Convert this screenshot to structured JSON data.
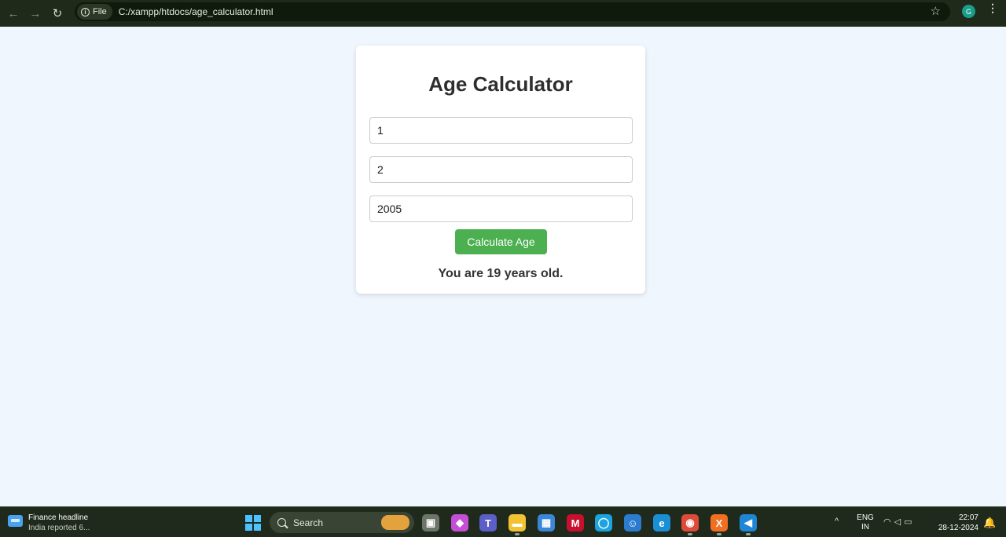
{
  "browser": {
    "back_glyph": "←",
    "forward_glyph": "→",
    "reload_glyph": "↻",
    "file_chip_label": "File",
    "info_glyph": "i",
    "url": "C:/xampp/htdocs/age_calculator.html",
    "star_glyph": "☆",
    "profile_initial": "G",
    "menu_glyph": "⋮"
  },
  "app": {
    "title": "Age Calculator",
    "day_value": "1",
    "month_value": "2",
    "year_value": "2005",
    "button_label": "Calculate Age",
    "result_text": "You are 19 years old.",
    "button_color": "#4caf50"
  },
  "taskbar": {
    "widget_title": "Finance headline",
    "widget_subtitle": "India reported 6...",
    "search_label": "Search",
    "apps": [
      {
        "name": "task-view",
        "glyph": "▣",
        "color": "#6d7468"
      },
      {
        "name": "copilot",
        "glyph": "◆",
        "color": "#c44fd6"
      },
      {
        "name": "teams",
        "glyph": "T",
        "color": "#5b5fc7"
      },
      {
        "name": "file-explorer",
        "glyph": "▬",
        "color": "#f2c233"
      },
      {
        "name": "microsoft-store",
        "glyph": "▦",
        "color": "#3a86d8"
      },
      {
        "name": "mcafee",
        "glyph": "M",
        "color": "#c8102e"
      },
      {
        "name": "alexa",
        "glyph": "◯",
        "color": "#1aa5e0"
      },
      {
        "name": "people",
        "glyph": "☺",
        "color": "#2b7ccf"
      },
      {
        "name": "edge",
        "glyph": "e",
        "color": "#1b8fd6"
      },
      {
        "name": "chrome",
        "glyph": "◉",
        "color": "#dd4b39"
      },
      {
        "name": "xampp",
        "glyph": "X",
        "color": "#f26f21"
      },
      {
        "name": "vscode",
        "glyph": "◀",
        "color": "#1f86d6"
      }
    ],
    "lang_line1": "ENG",
    "lang_line2": "IN",
    "time": "22:07",
    "date": "28-12-2024",
    "chevron_glyph": "^",
    "bell_glyph": "🔔"
  }
}
